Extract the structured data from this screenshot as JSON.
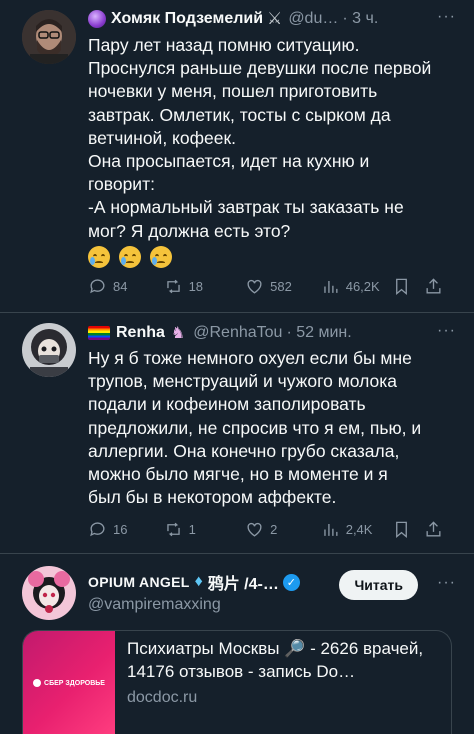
{
  "tweets": [
    {
      "author": "Хомяк Подземелий",
      "handle": "@du…",
      "time": "· 3 ч.",
      "lines": [
        "Пару лет назад помню ситуацию.",
        "Проснулся раньше девушки после первой",
        "ночевки у меня, пошел приготовить",
        "завтрак. Омлетик, тосты с сырком да",
        "ветчиной, кофеек.",
        "Она просыпается, идет на кухню и",
        "говорит:",
        "-А нормальный завтрак ты заказать не",
        "мог? Я должна есть это?"
      ],
      "emoji": [
        "crying-face",
        "crying-face",
        "crying-face"
      ],
      "actions": {
        "replies": "84",
        "reposts": "18",
        "likes": "582",
        "views": "46,2K"
      }
    },
    {
      "author": "Renha",
      "handle": "@RenhaTou",
      "time": "· 52 мин.",
      "lines": [
        "Ну я б тоже немного охуел если бы мне",
        "трупов, менструаций и чужого молока",
        "подали и кофеином заполировать",
        "предложили, не спросив что я ем, пью, и",
        "аллергии. Она конечно грубо сказала,",
        "можно было мягче, но в моменте и я",
        "был бы в некотором аффекте."
      ],
      "actions": {
        "replies": "16",
        "reposts": "1",
        "likes": "2",
        "views": "2,4K"
      }
    }
  ],
  "promoted": {
    "author": "OPIUM ANGEL",
    "author_suffix": "鸦片 /4-…",
    "handle": "@vampiremaxxing",
    "follow_label": "Читать",
    "ad_text": "Психиатры Москвы 🔎 - 2626 врачей, 14176 отзывов - запись Do…",
    "ad_url": "docdoc.ru",
    "ad_logo": "СБЕР ЗДОРОВЬЕ"
  },
  "colors": {
    "background": "#15202b",
    "text": "#f7f9f9",
    "muted": "#8b98a5",
    "divider": "#38444d",
    "verified": "#1d9bf0"
  }
}
